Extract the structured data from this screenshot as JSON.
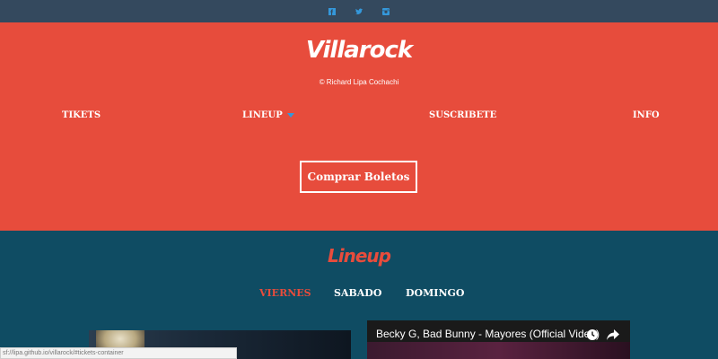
{
  "social": {
    "icons": [
      "facebook-icon",
      "twitter-icon",
      "instagram-icon"
    ],
    "color": "#3498db"
  },
  "hero": {
    "logo": "Villarock",
    "credit": "© Richard Lipa Cochachi",
    "nav": {
      "tikets": "Tikets",
      "lineup": "Lineup",
      "suscribete": "Suscribete",
      "info": "Info"
    },
    "buy_button": "Comprar Boletos",
    "background": "#e74c3c"
  },
  "lineup": {
    "title": "Lineup",
    "tabs": {
      "viernes": "Viernes",
      "sabado": "Sabado",
      "domingo": "Domingo"
    },
    "active_tab": "Viernes",
    "background": "#0f4c63"
  },
  "video": {
    "title": "Becky G, Bad Bunny - Mayores (Official Video)",
    "icons": [
      "clock-icon",
      "share-icon"
    ]
  },
  "status": {
    "url": "sf://lipa.github.io/villarock/#tickets-container"
  }
}
